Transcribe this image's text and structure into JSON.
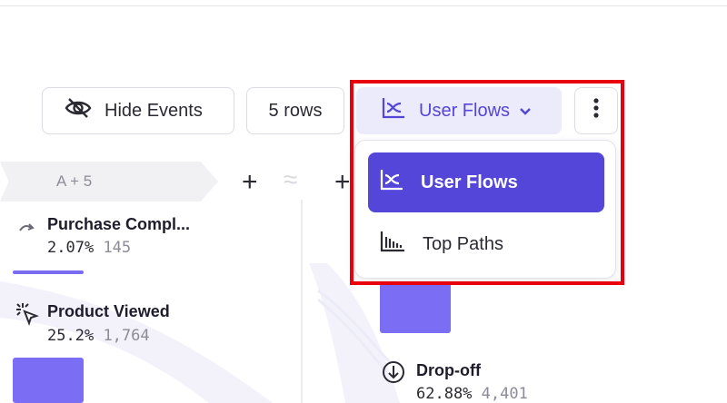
{
  "toolbar": {
    "hide_events_label": "Hide Events",
    "rows_label": "5 rows",
    "view_mode_label": "User Flows",
    "more_icon": "kebab-vertical-icon"
  },
  "dropdown": {
    "items": [
      {
        "label": "User Flows",
        "icon": "user-flows-icon",
        "selected": true
      },
      {
        "label": "Top Paths",
        "icon": "top-paths-icon",
        "selected": false
      }
    ]
  },
  "flow": {
    "step_label": "A + 5",
    "nodes": [
      {
        "name": "Purchase Compl...",
        "percent": "2.07%",
        "count": "145"
      },
      {
        "name": "Product Viewed",
        "percent": "25.2%",
        "count": "1,764"
      },
      {
        "name": "Drop-off",
        "percent": "62.88%",
        "count": "4,401"
      }
    ]
  },
  "colors": {
    "accent": "#5346d9",
    "accent_light": "#ecebfb",
    "bar": "#7c6df5",
    "highlight": "#e8000c"
  }
}
